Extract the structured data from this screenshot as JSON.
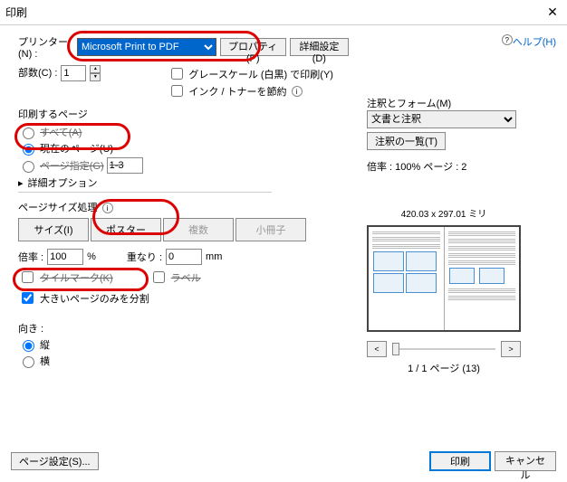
{
  "window": {
    "title": "印刷"
  },
  "printer": {
    "label": "プリンター(N) :",
    "selected": "Microsoft Print to PDF",
    "properties_btn": "プロパティ(P)",
    "advanced_btn": "詳細設定(D)",
    "help": "ヘルプ(H)"
  },
  "copies": {
    "label": "部数(C) :",
    "value": "1"
  },
  "options": {
    "grayscale": "グレースケール (白黒) で印刷(Y)",
    "savetoner": "インク / トナーを節約"
  },
  "range": {
    "title": "印刷するページ",
    "all": "すべて(A)",
    "current": "現在のページ(U)",
    "pages": "ページ指定(G)",
    "pages_value": "1-3",
    "more": "詳細オプション"
  },
  "pagesize": {
    "title": "ページサイズ処理",
    "size_btn": "サイズ(I)",
    "poster_btn": "ポスター",
    "multiple_btn": "複数",
    "booklet_btn": "小冊子"
  },
  "poster": {
    "scale_label": "倍率 :",
    "scale_value": "100",
    "scale_unit": "%",
    "overlap_label": "重なり :",
    "overlap_value": "0",
    "overlap_unit": "mm",
    "tilemark": "タイルマーク(K)",
    "labels": "ラベル",
    "split_large": "大きいページのみを分割"
  },
  "orientation": {
    "title": "向き :",
    "portrait": "縦",
    "landscape": "横"
  },
  "annotations": {
    "title": "注釈とフォーム(M)",
    "selected": "文書と注釈",
    "list_btn": "注釈の一覧(T)"
  },
  "preview": {
    "info": "倍率 : 100% ページ : 2",
    "dim": "420.03 x 297.01 ミリ",
    "page_count": "1 / 1 ページ (13)"
  },
  "footer": {
    "page_setup": "ページ設定(S)...",
    "print": "印刷",
    "cancel": "キャンセル"
  }
}
